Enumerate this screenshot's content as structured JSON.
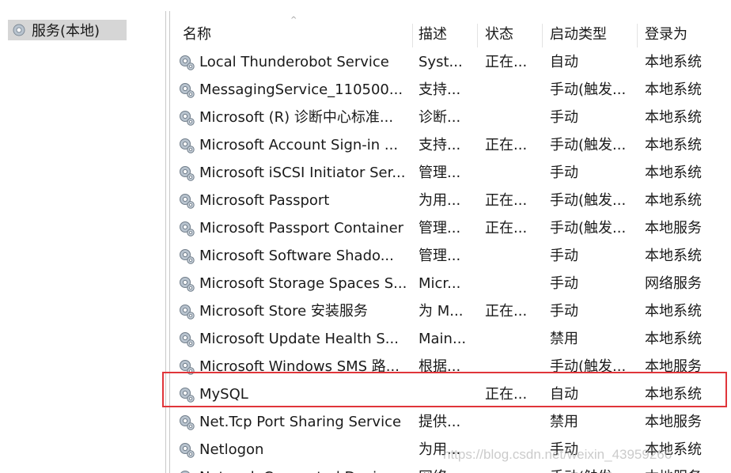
{
  "tree": {
    "root_label": "服务(本地)"
  },
  "columns": {
    "name": "名称",
    "description": "描述",
    "status": "状态",
    "startup_type": "启动类型",
    "log_on_as": "登录为"
  },
  "services": [
    {
      "name": "Local Thunderobot Service",
      "description": "Syst...",
      "status": "正在...",
      "startup_type": "自动",
      "log_on_as": "本地系统"
    },
    {
      "name": "MessagingService_110500...",
      "description": "支持...",
      "status": "",
      "startup_type": "手动(触发...",
      "log_on_as": "本地系统"
    },
    {
      "name": "Microsoft (R) 诊断中心标准...",
      "description": "诊断...",
      "status": "",
      "startup_type": "手动",
      "log_on_as": "本地系统"
    },
    {
      "name": "Microsoft Account Sign-in ...",
      "description": "支持...",
      "status": "正在...",
      "startup_type": "手动(触发...",
      "log_on_as": "本地系统"
    },
    {
      "name": "Microsoft iSCSI Initiator Ser...",
      "description": "管理...",
      "status": "",
      "startup_type": "手动",
      "log_on_as": "本地系统"
    },
    {
      "name": "Microsoft Passport",
      "description": "为用...",
      "status": "正在...",
      "startup_type": "手动(触发...",
      "log_on_as": "本地系统"
    },
    {
      "name": "Microsoft Passport Container",
      "description": "管理...",
      "status": "正在...",
      "startup_type": "手动(触发...",
      "log_on_as": "本地服务"
    },
    {
      "name": "Microsoft Software Shado...",
      "description": "管理...",
      "status": "",
      "startup_type": "手动",
      "log_on_as": "本地系统"
    },
    {
      "name": "Microsoft Storage Spaces S...",
      "description": "Micr...",
      "status": "",
      "startup_type": "手动",
      "log_on_as": "网络服务"
    },
    {
      "name": "Microsoft Store 安装服务",
      "description": "为 M...",
      "status": "正在...",
      "startup_type": "手动",
      "log_on_as": "本地系统"
    },
    {
      "name": "Microsoft Update Health S...",
      "description": "Main...",
      "status": "",
      "startup_type": "禁用",
      "log_on_as": "本地系统"
    },
    {
      "name": "Microsoft Windows SMS 路...",
      "description": "根据...",
      "status": "",
      "startup_type": "手动(触发...",
      "log_on_as": "本地服务"
    },
    {
      "name": "MySQL",
      "description": "",
      "status": "正在...",
      "startup_type": "自动",
      "log_on_as": "本地系统"
    },
    {
      "name": "Net.Tcp Port Sharing Service",
      "description": "提供...",
      "status": "",
      "startup_type": "禁用",
      "log_on_as": "本地服务"
    },
    {
      "name": "Netlogon",
      "description": "为用...",
      "status": "",
      "startup_type": "手动",
      "log_on_as": "本地系统"
    },
    {
      "name": "Network Connected Devic...",
      "description": "网络...",
      "status": "",
      "startup_type": "手动(触发...",
      "log_on_as": "本地服务"
    }
  ],
  "watermark": "https://blog.csdn.net/weixin_43959266",
  "colors": {
    "highlight_border": "#e0353a",
    "tree_selected_bg": "#d6d6d6"
  },
  "icons": {
    "service": "gear-icon",
    "sort": "sort-ascending-icon"
  }
}
